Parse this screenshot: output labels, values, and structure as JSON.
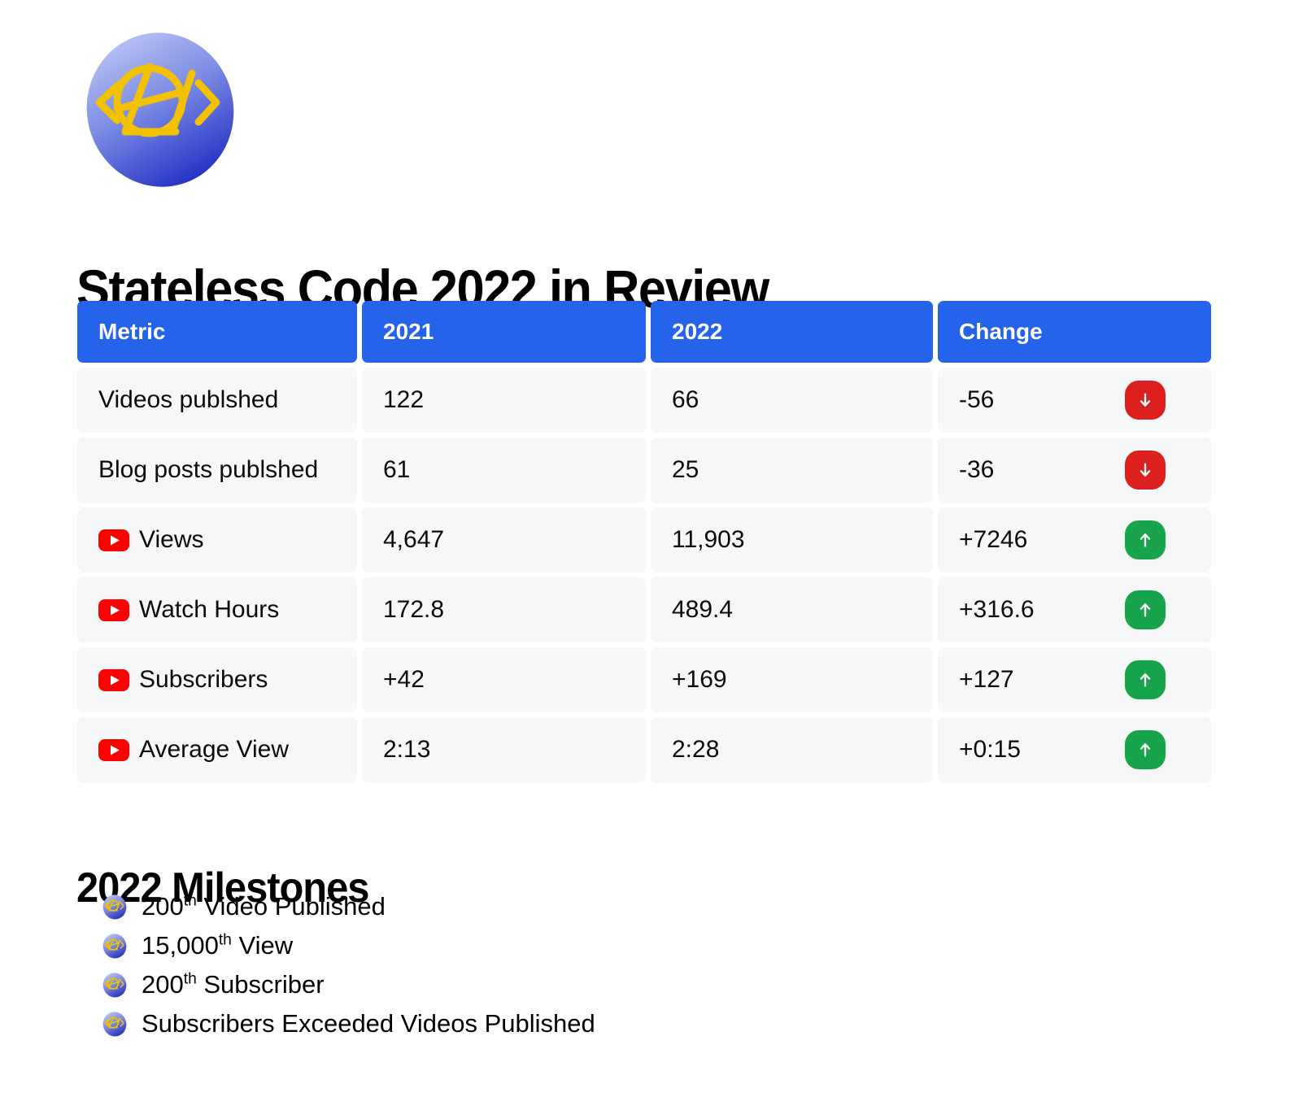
{
  "brand": {
    "logo_name": "stateless-code-anarchy-logo",
    "gradient_top": "#a8b4ee",
    "gradient_bottom": "#2d3fcf",
    "mark_color": "#f2c200",
    "mark_text": "</>"
  },
  "header": {
    "title": "Stateless Code 2022 in Review"
  },
  "table": {
    "accent_color": "#2563eb",
    "cell_color": "#f6f7f9",
    "columns": [
      "Metric",
      "2021",
      "2022",
      "Change"
    ],
    "rows": [
      {
        "metric": "Videos publshed",
        "icon": null,
        "y2021": "122",
        "y2022": "66",
        "change": "-56",
        "direction": "down"
      },
      {
        "metric": "Blog posts publshed",
        "icon": null,
        "y2021": "61",
        "y2022": "25",
        "change": "-36",
        "direction": "down"
      },
      {
        "metric": "Views",
        "icon": "youtube-icon",
        "y2021": "4,647",
        "y2022": "11,903",
        "change": "+7246",
        "direction": "up"
      },
      {
        "metric": "Watch Hours",
        "icon": "youtube-icon",
        "y2021": "172.8",
        "y2022": "489.4",
        "change": "+316.6",
        "direction": "up"
      },
      {
        "metric": "Subscribers",
        "icon": "youtube-icon",
        "y2021": "+42",
        "y2022": "+169",
        "change": "+127",
        "direction": "up"
      },
      {
        "metric": "Average View",
        "icon": "youtube-icon",
        "y2021": "2:13",
        "y2022": "2:28",
        "change": "+0:15",
        "direction": "up"
      }
    ],
    "badge_colors": {
      "up": "#17a44a",
      "down": "#dc2020"
    }
  },
  "milestones": {
    "heading": "2022 Milestones",
    "items": [
      {
        "number": "200",
        "ordinal": "th",
        "text": " Video Published"
      },
      {
        "number": "15,000",
        "ordinal": "th",
        "text": " View"
      },
      {
        "number": "200",
        "ordinal": "th",
        "text": " Subscriber"
      },
      {
        "number": "Subscribers Exceeded Videos Published",
        "ordinal": "",
        "text": ""
      }
    ]
  }
}
